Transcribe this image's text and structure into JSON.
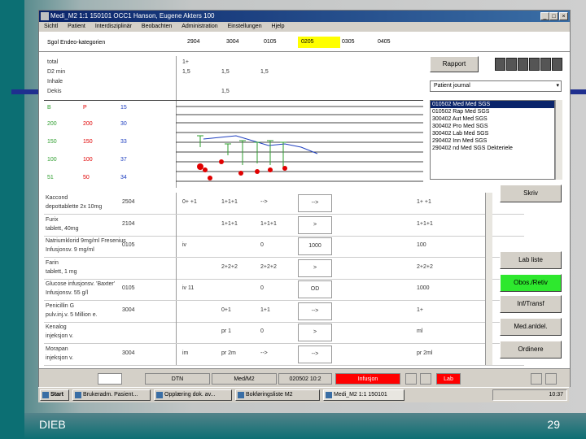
{
  "slide": {
    "footer_left": "DIEB",
    "footer_right": "29"
  },
  "window": {
    "title": "Medi_M2  1:1  150101 OCC1  Hanson, Eugene  Akters 100",
    "menu": [
      "Sichtl",
      "Patient",
      "Interdisziplinär",
      "Beobachten",
      "Administration",
      "Einstellungen",
      "Hjelp"
    ]
  },
  "header": {
    "label": "Sgol  Endeo-kategorien",
    "times": [
      "2904",
      "3004",
      "0105",
      "0205",
      "0305",
      "0405"
    ],
    "highlight_index": 3,
    "highlight_color": "#ffff00"
  },
  "vitals": {
    "rows": [
      {
        "label": "total",
        "values": [
          "1+",
          "",
          ""
        ]
      },
      {
        "label": "D2 min",
        "values": [
          "1,5",
          "1,5",
          "1,5"
        ]
      },
      {
        "label": "Inhale",
        "values": [
          "",
          "",
          ""
        ]
      },
      {
        "label": "Dekis",
        "values": [
          "",
          "1,5",
          ""
        ]
      }
    ],
    "scale": [
      {
        "a": "B",
        "b": "P",
        "c": "15"
      },
      {
        "a": "200",
        "b": "200",
        "c": "30"
      },
      {
        "a": "150",
        "b": "150",
        "c": "33"
      },
      {
        "a": "100",
        "b": "100",
        "c": "37"
      },
      {
        "a": "51",
        "b": "50",
        "c": "34"
      }
    ],
    "colors": {
      "green": "#2e9e2e",
      "red": "#e00000",
      "blue": "#2040c0"
    }
  },
  "right_panel": {
    "rapport_label": "Rapport",
    "journal_select": "Patient journal",
    "list_rows": [
      "010502 Med  Med  SGS",
      "010502 Rap  Med  SGS",
      "300402 Aut  Med  SGS",
      "300402 Pro  Med  SGS",
      "300402 Lab  Med  SGS",
      "290402 Inn  Med  SGS",
      "290402 nd   Med  SGS  Dekteriele"
    ],
    "buttons": [
      {
        "label": "Skriv",
        "color": "#d4d0c8"
      },
      {
        "label": "Lab liste",
        "color": "#d4d0c8"
      },
      {
        "label": "Obos./Retiv",
        "color": "#2ee82e"
      },
      {
        "label": "Inf/Transf",
        "color": "#d4d0c8"
      },
      {
        "label": "Med.anldel.",
        "color": "#d4d0c8"
      },
      {
        "label": "Ordinere",
        "color": "#d4d0c8"
      }
    ]
  },
  "orders": [
    {
      "name": "Kaccond",
      "detail": "depottablette 2x 10mg",
      "code": "2504",
      "c1": "0+ +1",
      "c2": "1+1+1",
      "c3": "-->",
      "c4": "-->",
      "c5": "1+ +1"
    },
    {
      "name": "Furix",
      "detail": "tablett, 40mg",
      "code": "2104",
      "c1": "",
      "c2": "1+1+1",
      "c3": "1+1+1",
      "c4": ">",
      "c5": "1+1+1"
    },
    {
      "name": "Natriumklorid 9mg/ml Fresenius",
      "detail": "Infusjonsv. 9 mg/ml",
      "code": "0105",
      "c1": "iv",
      "c2": "",
      "c3": "0",
      "c4": "1000",
      "c5": "100"
    },
    {
      "name": "Farin",
      "detail": "tablett, 1 mg",
      "code": "",
      "c1": "",
      "c2": "2+2+2",
      "c3": "2+2+2",
      "c4": ">",
      "c5": "2+2+2"
    },
    {
      "name": "Glucose infusjonsv. 'Baxter'",
      "detail": "Infusjonsv. 55 g/l",
      "code": "0105",
      "c1": "iv 11",
      "c2": "",
      "c3": "0",
      "c4": "OD",
      "c5": "1000"
    },
    {
      "name": "Penicillin G",
      "detail": "pulv.inj.v. 5 Million e.",
      "code": "3004",
      "c1": "",
      "c2": "0+1",
      "c3": "1+1",
      "c4": "-->",
      "c5": "1+"
    },
    {
      "name": "Kenalog",
      "detail": "injeksjon v.",
      "code": "",
      "c1": "",
      "c2": "pr 1",
      "c3": "0",
      "c4": ">",
      "c5": "ml"
    },
    {
      "name": "Morapan",
      "detail": "injeksjon v.",
      "code": "3004",
      "c1": "im",
      "c2": "pr 2m",
      "c3": "-->",
      "c4": "-->",
      "c5": "pr 2ml"
    }
  ],
  "statusbar": {
    "items": [
      "DTN",
      "Med/M2",
      "020502 10:2",
      "Infusjon",
      "Lab"
    ],
    "alert_color": "#ff0000"
  },
  "taskbar": {
    "start": "Start",
    "items": [
      "Brukeradm. Pasient...",
      "Opplæring dok. av...",
      "Bokføringsliste M2",
      "Medi_M2  1:1  150101"
    ],
    "clock": "10:37"
  }
}
